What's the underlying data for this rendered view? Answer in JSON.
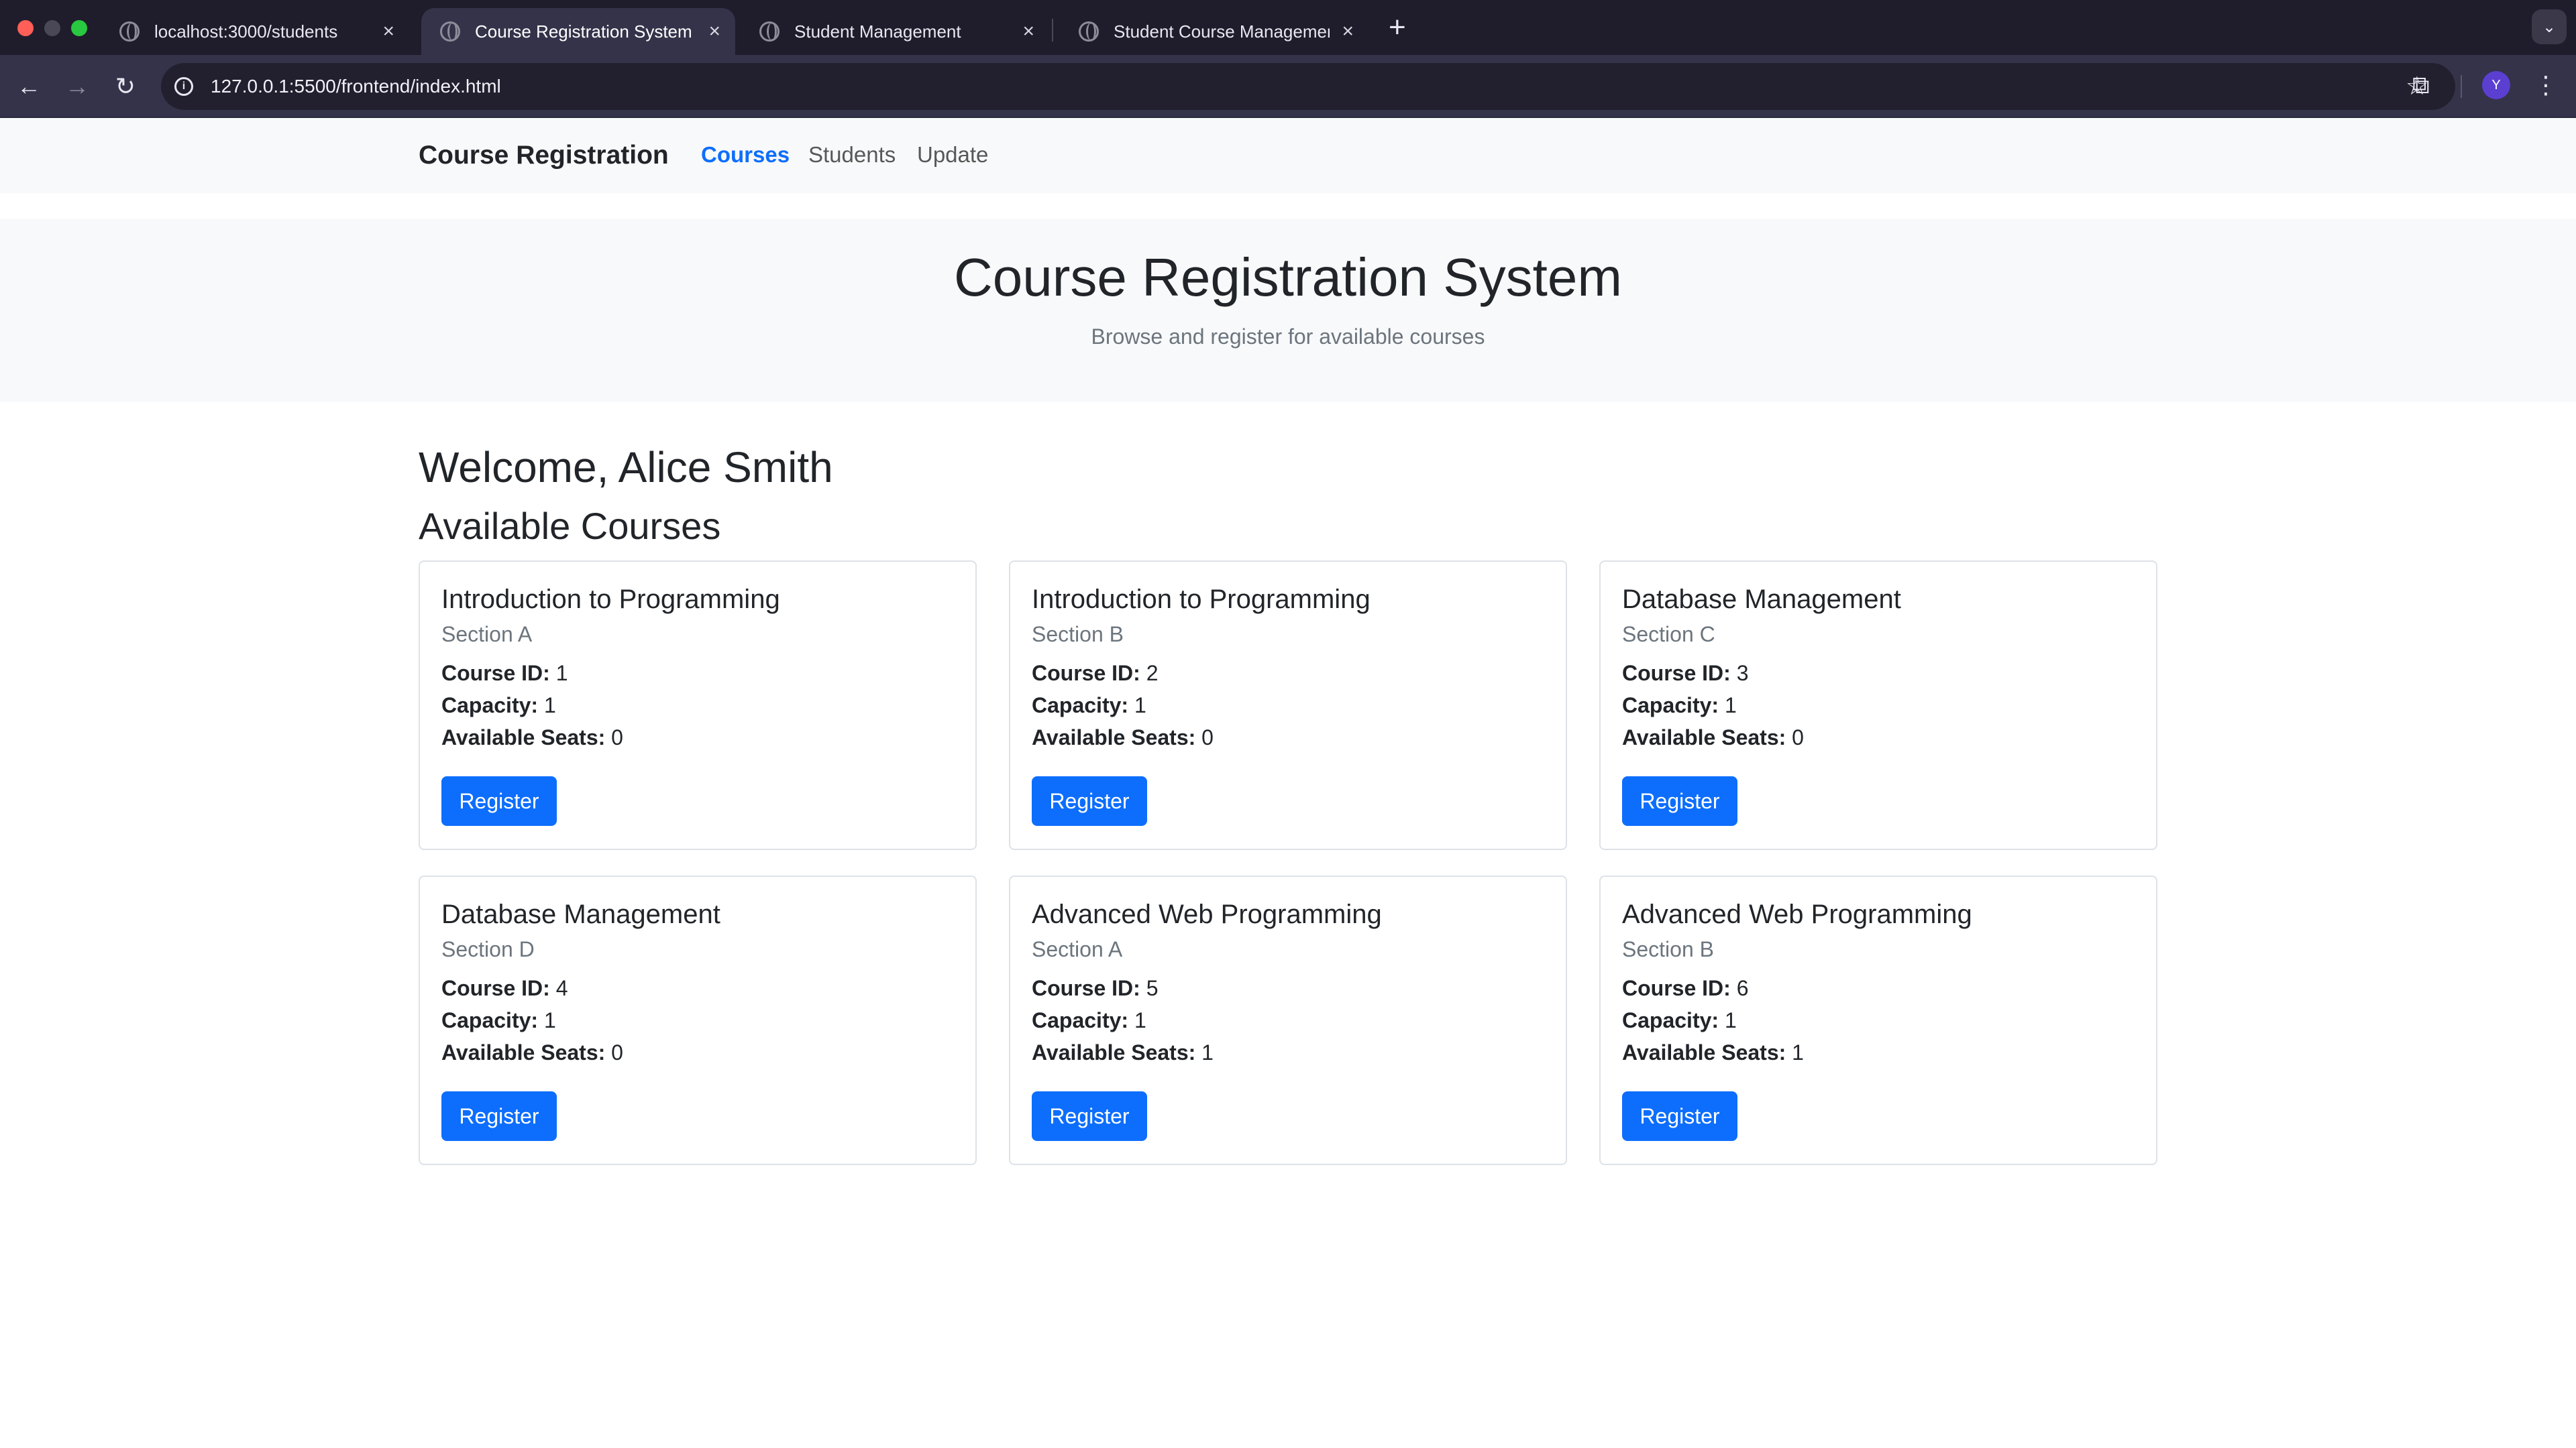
{
  "browser": {
    "tabs": [
      {
        "title": "localhost:3000/students",
        "active": false
      },
      {
        "title": "Course Registration System",
        "active": true
      },
      {
        "title": "Student Management",
        "active": false
      },
      {
        "title": "Student Course Management",
        "active": false
      }
    ],
    "url": "127.0.0.1:5500/frontend/index.html",
    "profile_initial": "Y"
  },
  "nav": {
    "brand": "Course Registration",
    "links": [
      "Courses",
      "Students",
      "Update"
    ]
  },
  "hero": {
    "title": "Course Registration System",
    "subtitle": "Browse and register for available courses"
  },
  "main": {
    "welcome": "Welcome, Alice Smith",
    "heading": "Available Courses"
  },
  "labels": {
    "course_id": "Course ID:",
    "capacity": "Capacity:",
    "seats": "Available Seats:",
    "register": "Register"
  },
  "courses": [
    {
      "name": "Introduction to Programming",
      "section": "Section A",
      "id": "1",
      "capacity": "1",
      "seats": "0"
    },
    {
      "name": "Introduction to Programming",
      "section": "Section B",
      "id": "2",
      "capacity": "1",
      "seats": "0"
    },
    {
      "name": "Database Management",
      "section": "Section C",
      "id": "3",
      "capacity": "1",
      "seats": "0"
    },
    {
      "name": "Database Management",
      "section": "Section D",
      "id": "4",
      "capacity": "1",
      "seats": "0"
    },
    {
      "name": "Advanced Web Programming",
      "section": "Section A",
      "id": "5",
      "capacity": "1",
      "seats": "1"
    },
    {
      "name": "Advanced Web Programming",
      "section": "Section B",
      "id": "6",
      "capacity": "1",
      "seats": "1"
    }
  ],
  "colors": {
    "primary": "#0d6efd",
    "muted": "#6c757d",
    "light": "#f8f9fa"
  }
}
